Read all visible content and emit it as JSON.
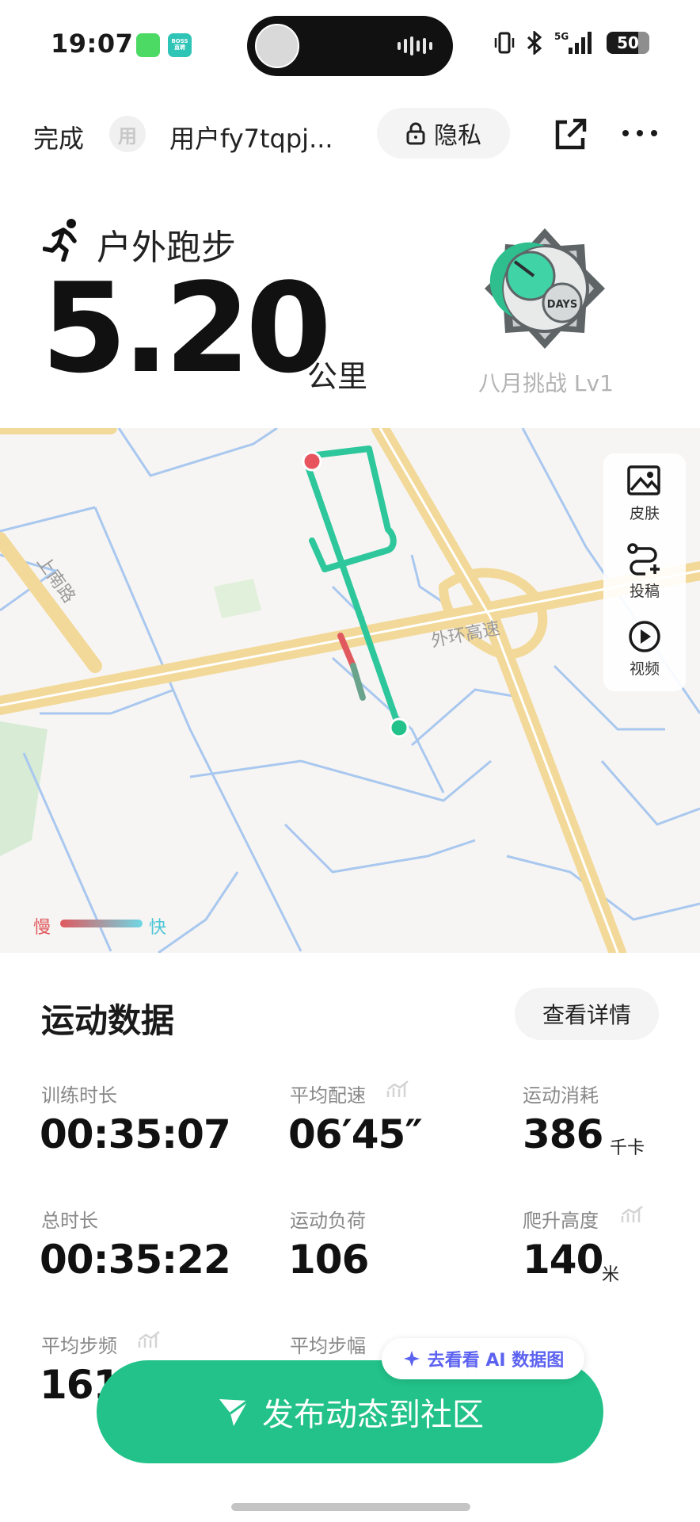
{
  "status_bar": {
    "time": "19:07",
    "app_badge_text": "BOSS 直聘",
    "network": "5G",
    "battery": "50"
  },
  "nav": {
    "done_label": "完成",
    "avatar_char": "用",
    "user_name": "用户fy7tqpj...",
    "privacy_label": "隐私"
  },
  "activity": {
    "type": "户外跑步",
    "distance": "5.20",
    "unit": "公里",
    "badge_label": "八月挑战 Lv1",
    "badge_text": "DAYS"
  },
  "map": {
    "road_label_1": "上南路",
    "road_label_2": "外环高速",
    "tools": [
      {
        "label": "皮肤",
        "icon": "image-icon"
      },
      {
        "label": "投稿",
        "icon": "route-add-icon"
      },
      {
        "label": "视频",
        "icon": "play-icon"
      }
    ],
    "legend_slow": "慢",
    "legend_fast": "快",
    "route_colors": {
      "fast": "#2ec79b",
      "slow": "#e0595f",
      "start": "#22c28a",
      "end": "#e8545e"
    }
  },
  "sports_data": {
    "title": "运动数据",
    "details_label": "查看详情",
    "metrics": [
      {
        "label": "训练时长",
        "value": "00:35:07",
        "unit": ""
      },
      {
        "label": "平均配速",
        "value": "06′45″",
        "unit": ""
      },
      {
        "label": "运动消耗",
        "value": "386",
        "unit": "千卡"
      },
      {
        "label": "总时长",
        "value": "00:35:22",
        "unit": ""
      },
      {
        "label": "运动负荷",
        "value": "106",
        "unit": ""
      },
      {
        "label": "爬升高度",
        "value": "140",
        "unit": "米"
      },
      {
        "label": "平均步频",
        "value": "161",
        "unit": ""
      },
      {
        "label": "平均步幅",
        "value": "",
        "unit": ""
      }
    ]
  },
  "ai_pill_label": "去看看 AI 数据图",
  "publish_label": "发布动态到社区",
  "colors": {
    "accent": "#22c28a",
    "ai": "#5c62f0"
  }
}
